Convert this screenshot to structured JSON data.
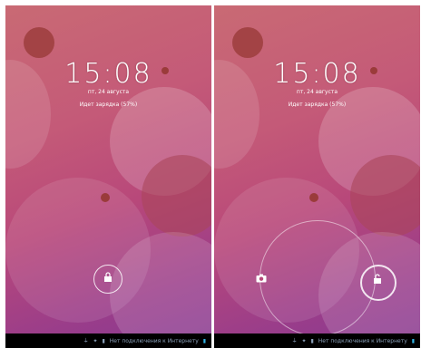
{
  "left": {
    "time": "15:08",
    "date": "пт, 24 августа",
    "charge": "Идет зарядка (57%)",
    "lock_icon": "lock-icon",
    "status": {
      "network_text": "Нет подключения к Интернету",
      "icons": [
        "usb-icon",
        "android-icon",
        "sd-icon",
        "battery-icon"
      ]
    }
  },
  "right": {
    "time": "15:08",
    "date": "пт, 24 августа",
    "charge": "Идет зарядка (57%)",
    "unlock_icon": "unlock-icon",
    "camera_icon": "camera-icon",
    "status": {
      "network_text": "Нет подключения к Интернету",
      "icons": [
        "usb-icon",
        "android-icon",
        "sd-icon",
        "battery-icon"
      ]
    }
  },
  "colors": {
    "wallpaper_top": "#c96a74",
    "wallpaper_bottom": "#8a3a90",
    "navbar": "#000000",
    "status_text": "#8aa0b8"
  }
}
